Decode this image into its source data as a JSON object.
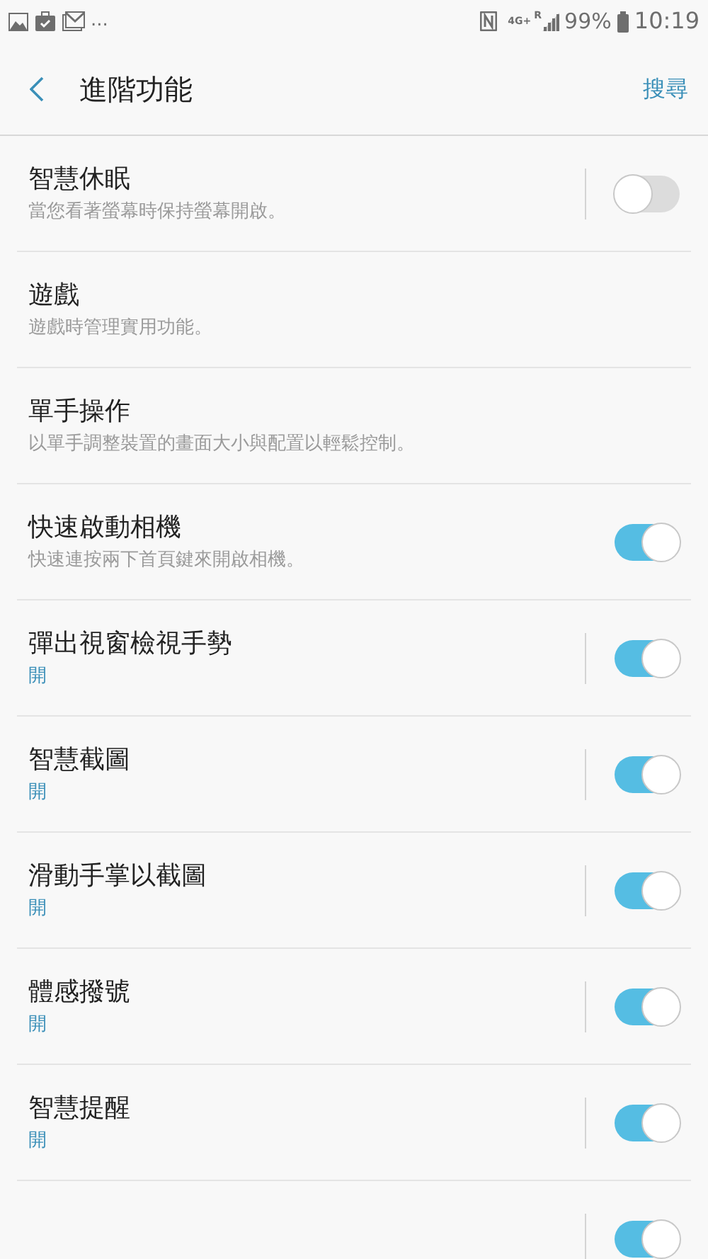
{
  "status_bar": {
    "overflow": "...",
    "network": "4G+",
    "roaming": "R",
    "battery": "99%",
    "time": "10:19"
  },
  "header": {
    "title": "進階功能",
    "action": "搜尋"
  },
  "items": [
    {
      "kind": "description",
      "title": "智慧休眠",
      "subtitle": "當您看著螢幕時保持螢幕開啟。",
      "on": false,
      "separator": true
    },
    {
      "kind": "description",
      "title": "遊戲",
      "subtitle": "遊戲時管理實用功能。"
    },
    {
      "kind": "description",
      "title": "單手操作",
      "subtitle": "以單手調整裝置的畫面大小與配置以輕鬆控制。"
    },
    {
      "kind": "description",
      "title": "快速啟動相機",
      "subtitle": "快速連按兩下首頁鍵來開啟相機。",
      "on": true,
      "separator": false
    },
    {
      "kind": "status",
      "title": "彈出視窗檢視手勢",
      "subtitle": "開",
      "on": true,
      "separator": true
    },
    {
      "kind": "status",
      "title": "智慧截圖",
      "subtitle": "開",
      "on": true,
      "separator": true
    },
    {
      "kind": "status",
      "title": "滑動手掌以截圖",
      "subtitle": "開",
      "on": true,
      "separator": true
    },
    {
      "kind": "status",
      "title": "體感撥號",
      "subtitle": "開",
      "on": true,
      "separator": true
    },
    {
      "kind": "status",
      "title": "智慧提醒",
      "subtitle": "開",
      "on": true,
      "separator": true
    },
    {
      "on": true,
      "separator": true
    }
  ]
}
